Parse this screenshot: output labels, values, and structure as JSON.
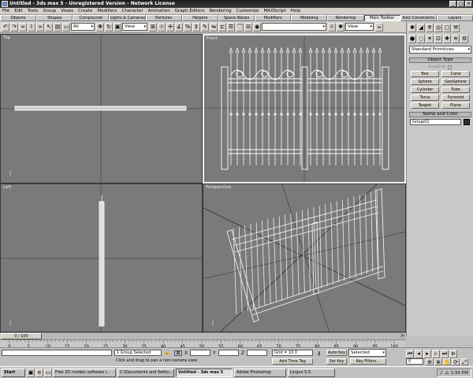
{
  "window": {
    "title": "Untitled - 3ds max 5 - Unregistered Version - Network License"
  },
  "menu": [
    "File",
    "Edit",
    "Tools",
    "Group",
    "Views",
    "Create",
    "Modifiers",
    "Character",
    "Animation",
    "Graph Editors",
    "Rendering",
    "Customize",
    "MAXScript",
    "Help"
  ],
  "tabs": [
    "Objects",
    "Shapes",
    "Compounds",
    "Lights & Cameras",
    "Particles",
    "Helpers",
    "Space Warps",
    "Modifiers",
    "Modeling",
    "Rendering",
    "Main Toolbar",
    "Axis Constraints",
    "Layers"
  ],
  "active_tab": "Main Toolbar",
  "toolbar": {
    "selection_filter": "All",
    "ref_coord": "View",
    "named_selection": "",
    "render_view": "View"
  },
  "viewports": {
    "top": "Top",
    "front": "Front",
    "left": "Left",
    "perspective": "Perspective"
  },
  "command_panel": {
    "category": "Standard Primitives",
    "object_type_header": "Object Type",
    "autogrid": "AutoGrid",
    "buttons": [
      "Box",
      "Cone",
      "Sphere",
      "GeoSphere",
      "Cylinder",
      "Tube",
      "Torus",
      "Pyramid",
      "Teapot",
      "Plane"
    ],
    "name_color_header": "Name and Color",
    "object_name": "Group01",
    "object_color": "#303030"
  },
  "timeline": {
    "frame": "0 / 100",
    "ticks": [
      "0",
      "5",
      "10",
      "15",
      "20",
      "25",
      "30",
      "35",
      "40",
      "45",
      "50",
      "55",
      "60",
      "65",
      "70",
      "75",
      "80",
      "85",
      "90",
      "95",
      "100"
    ]
  },
  "status": {
    "selection": "1 Group Selected",
    "prompt": "Click and drag to pan a non-camera view",
    "x_label": "X",
    "y_label": "Y",
    "z_label": "Z",
    "grid": "Grid = 10.0",
    "add_time_tag": "Add Time Tag",
    "auto_key": "Auto Key",
    "set_key": "Set Key",
    "key_mode": "Selected",
    "key_filters": "Key Filters...",
    "frame_field": "0"
  },
  "taskbar": {
    "start": "Start",
    "tasks": [
      "Free 3D models software i...",
      "C:\\Documents and Settin...",
      "Untitled - 3ds max 5",
      "Adobe Photoshop",
      "Lingvo 5.0"
    ],
    "active_task": "Untitled - 3ds max 5",
    "clock": "1:55 PM"
  }
}
